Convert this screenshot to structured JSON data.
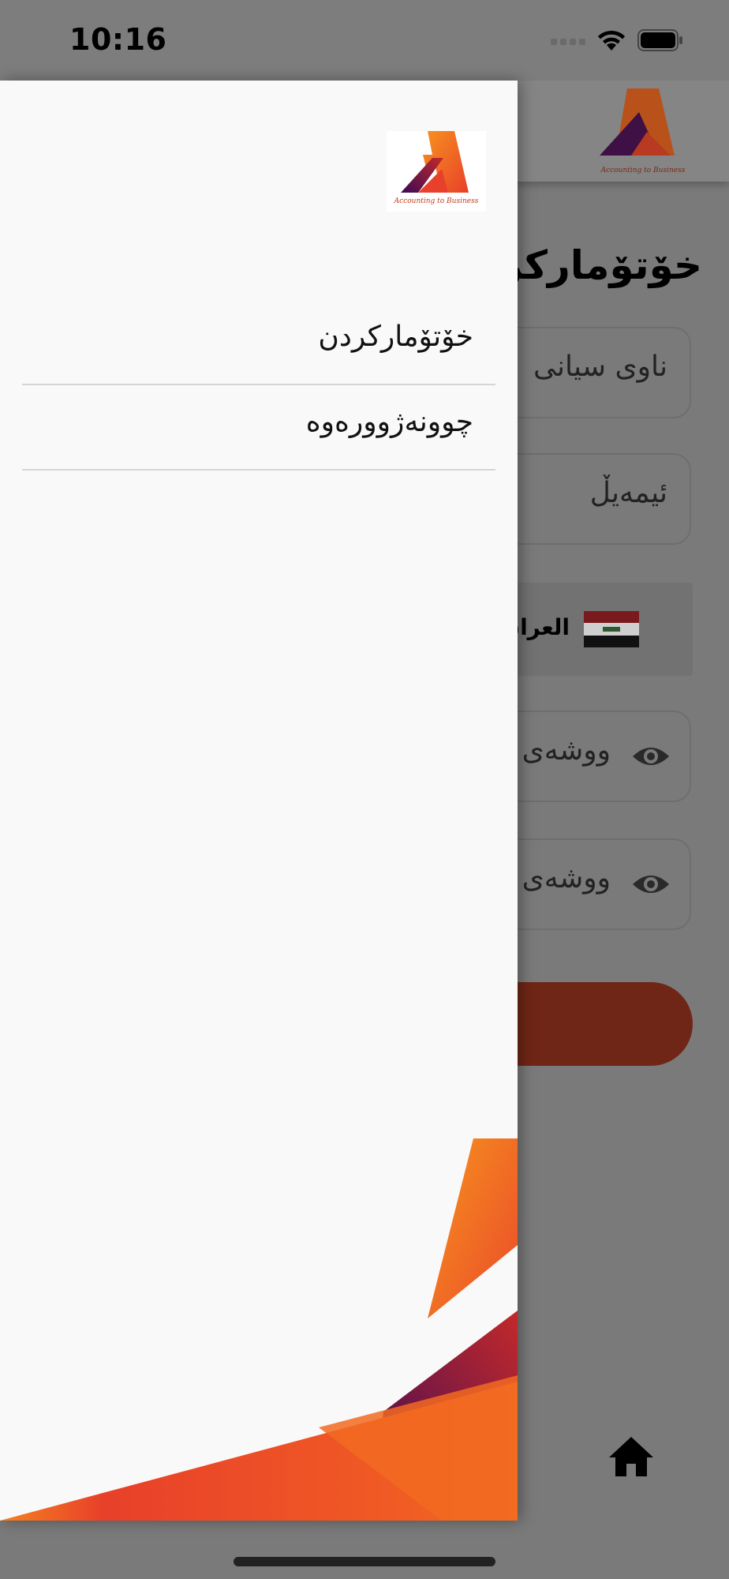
{
  "status_bar": {
    "time": "10:16"
  },
  "drawer": {
    "logo": {
      "caption": "Accounting to Business"
    },
    "items": [
      {
        "label": "خۆتۆمارکردن",
        "icon": "none"
      },
      {
        "label": "چوونەژوورەوە",
        "icon": "none"
      }
    ]
  },
  "background_screen": {
    "title": "خۆتۆمارکردن",
    "name_field_placeholder": "ناوی سیانی",
    "email_field_placeholder": "ئیمەیڵ",
    "country_name": "العراق",
    "password_field_placeholder": "ووشەی نهێنی",
    "confirm_password_field_placeholder": "ووشەی نهێنی",
    "logo_caption": "Accounting to Business"
  },
  "colors": {
    "accent_orange": "#f26a21",
    "accent_red": "#e3342b",
    "accent_purple": "#4a0b5c",
    "submit_button": "#6f2616"
  }
}
